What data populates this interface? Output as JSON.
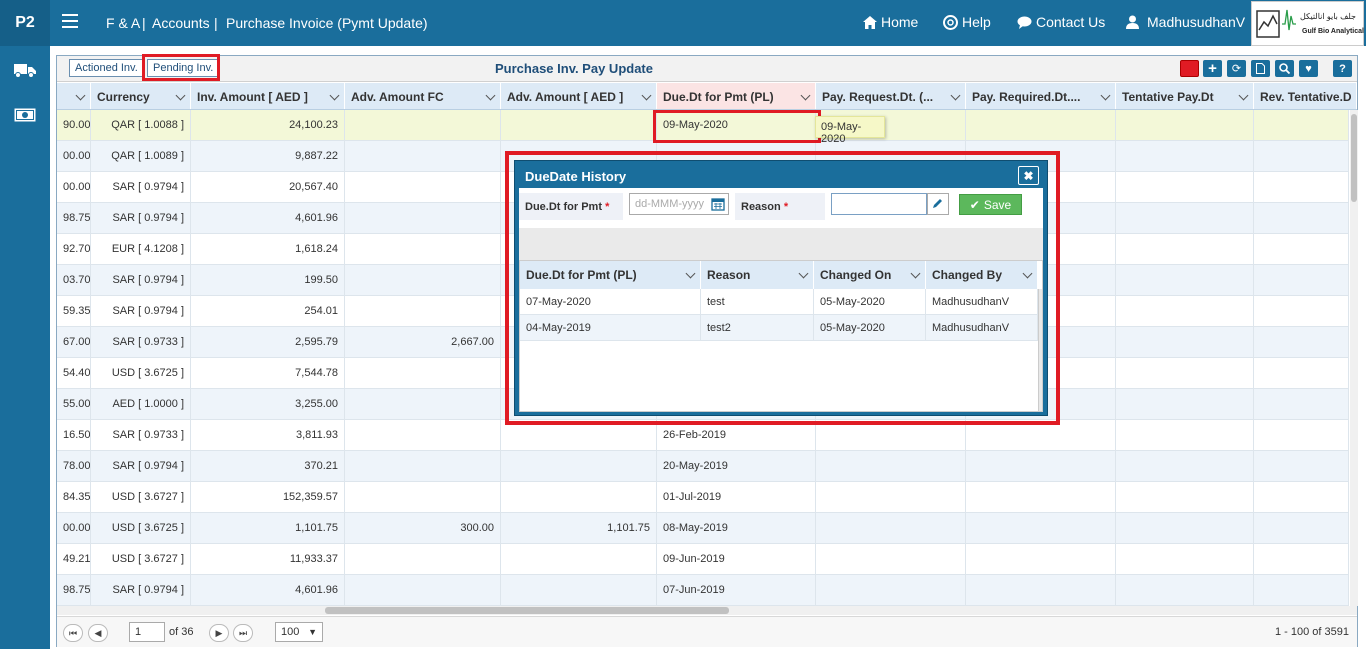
{
  "app": {
    "logo_text": "P2",
    "breadcrumb": [
      "F & A",
      "Accounts",
      "Purchase Invoice (Pymt Update)"
    ],
    "separator": "|"
  },
  "nav": {
    "home": "Home",
    "help": "Help",
    "contact": "Contact Us",
    "user": "MadhusudhanV"
  },
  "logo": {
    "arabic": "جلف بايو انالتيكل",
    "english": "Gulf Bio Analytical"
  },
  "panel": {
    "title": "Purchase Inv. Pay Update",
    "tabs": [
      "Actioned Inv.",
      "Pending Inv."
    ]
  },
  "columns": [
    "Currency",
    "Inv. Amount [ AED ]",
    "Adv. Amount FC",
    "Adv. Amount [ AED ]",
    "Due.Dt for Pmt (PL)",
    "Pay. Request.Dt. (...",
    "Pay. Required.Dt....",
    "Tentative Pay.Dt",
    "Rev. Tentative.D"
  ],
  "rows": [
    {
      "prev": "90.00",
      "currency": "QAR [ 1.0088 ]",
      "inv": "24,100.23",
      "advfc": "",
      "advaed": "",
      "due": "09-May-2020"
    },
    {
      "prev": "00.00",
      "currency": "QAR [ 1.0089 ]",
      "inv": "9,887.22",
      "advfc": "",
      "advaed": "",
      "due": ""
    },
    {
      "prev": "00.00",
      "currency": "SAR [ 0.9794 ]",
      "inv": "20,567.40",
      "advfc": "",
      "advaed": "",
      "due": ""
    },
    {
      "prev": "98.75",
      "currency": "SAR [ 0.9794 ]",
      "inv": "4,601.96",
      "advfc": "",
      "advaed": "",
      "due": ""
    },
    {
      "prev": "92.70",
      "currency": "EUR [ 4.1208 ]",
      "inv": "1,618.24",
      "advfc": "",
      "advaed": "",
      "due": ""
    },
    {
      "prev": "03.70",
      "currency": "SAR [ 0.9794 ]",
      "inv": "199.50",
      "advfc": "",
      "advaed": "",
      "due": ""
    },
    {
      "prev": "59.35",
      "currency": "SAR [ 0.9794 ]",
      "inv": "254.01",
      "advfc": "",
      "advaed": "",
      "due": ""
    },
    {
      "prev": "67.00",
      "currency": "SAR [ 0.9733 ]",
      "inv": "2,595.79",
      "advfc": "2,667.00",
      "advaed": "",
      "due": ""
    },
    {
      "prev": "54.40",
      "currency": "USD [ 3.6725 ]",
      "inv": "7,544.78",
      "advfc": "",
      "advaed": "",
      "due": ""
    },
    {
      "prev": "55.00",
      "currency": "AED [ 1.0000 ]",
      "inv": "3,255.00",
      "advfc": "",
      "advaed": "",
      "due": ""
    },
    {
      "prev": "16.50",
      "currency": "SAR [ 0.9733 ]",
      "inv": "3,811.93",
      "advfc": "",
      "advaed": "",
      "due": "26-Feb-2019"
    },
    {
      "prev": "78.00",
      "currency": "SAR [ 0.9794 ]",
      "inv": "370.21",
      "advfc": "",
      "advaed": "",
      "due": "20-May-2019"
    },
    {
      "prev": "84.35",
      "currency": "USD [ 3.6727 ]",
      "inv": "152,359.57",
      "advfc": "",
      "advaed": "",
      "due": "01-Jul-2019"
    },
    {
      "prev": "00.00",
      "currency": "USD [ 3.6725 ]",
      "inv": "1,101.75",
      "advfc": "300.00",
      "advaed": "1,101.75",
      "due": "08-May-2019"
    },
    {
      "prev": "49.21",
      "currency": "USD [ 3.6727 ]",
      "inv": "11,933.37",
      "advfc": "",
      "advaed": "",
      "due": "09-Jun-2019"
    },
    {
      "prev": "98.75",
      "currency": "SAR [ 0.9794 ]",
      "inv": "4,601.96",
      "advfc": "",
      "advaed": "",
      "due": "07-Jun-2019"
    }
  ],
  "tooltip": "09-May-2020",
  "pager": {
    "page": "1",
    "of": "of 36",
    "page_size": "100",
    "summary": "1 - 100 of 3591"
  },
  "modal": {
    "title": "DueDate History",
    "close": "✖",
    "due_label": "Due.Dt for Pmt",
    "required": "*",
    "due_placeholder": "dd-MMM-yyyy",
    "reason_label": "Reason",
    "save": "Save",
    "columns": [
      "Due.Dt for Pmt (PL)",
      "Reason",
      "Changed On",
      "Changed By"
    ],
    "rows": [
      {
        "due": "07-May-2020",
        "reason": "test",
        "on": "05-May-2020",
        "by": "MadhusudhanV"
      },
      {
        "due": "04-May-2019",
        "reason": "test2",
        "on": "05-May-2020",
        "by": "MadhusudhanV"
      }
    ]
  },
  "colors": {
    "header": "#1a6e9c",
    "highlight": "#e01b24",
    "save": "#5cb85c"
  }
}
